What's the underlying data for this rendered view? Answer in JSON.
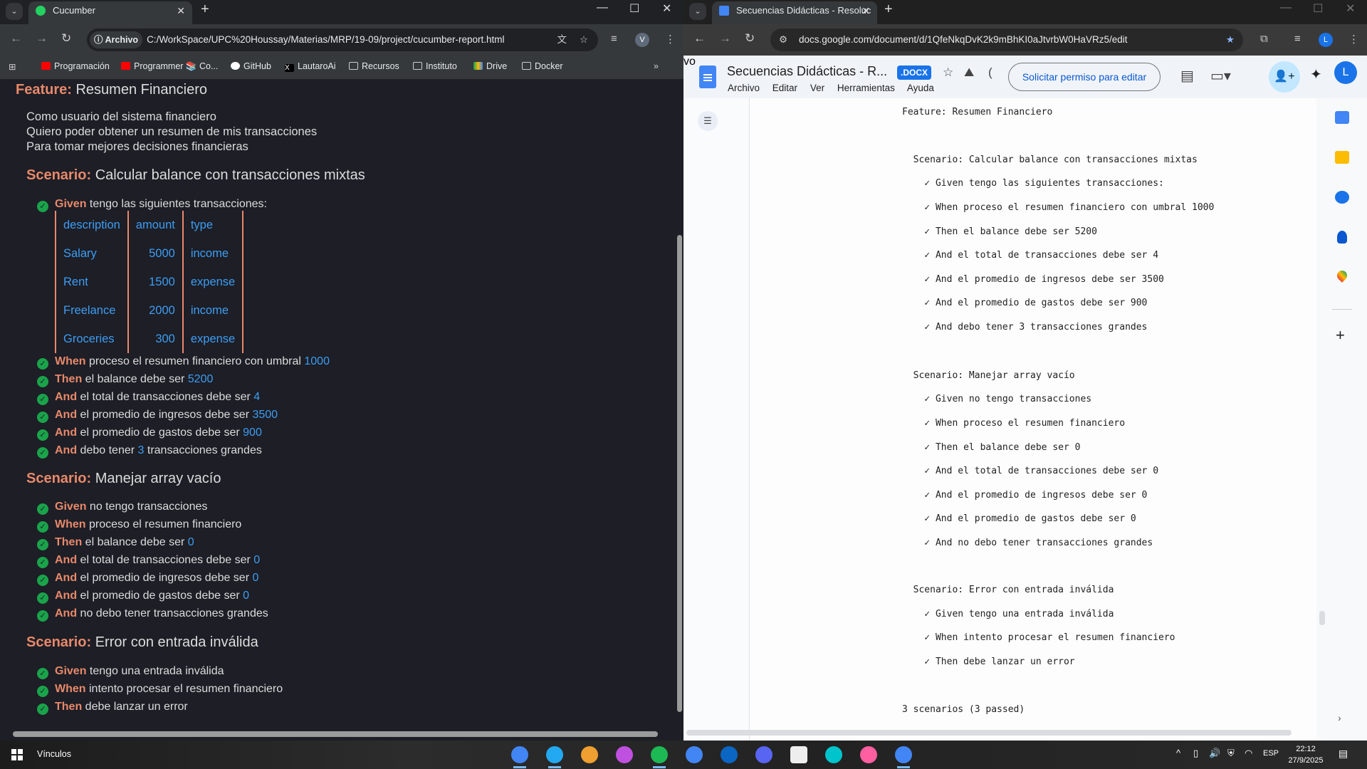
{
  "left_browser": {
    "tab_title": "Cucumber",
    "omnibox_chip": "Archivo",
    "url": "C:/WorkSpace/UPC%20Houssay/Materias/MRP/19-09/project/cucumber-report.html",
    "profile_initial": "V",
    "bookmarks": [
      "Programación",
      "Programmer 📚 Co...",
      "GitHub",
      "LautaroAi",
      "Recursos",
      "Instituto",
      "Drive",
      "Docker"
    ],
    "more_bookmarks": "»"
  },
  "report": {
    "feature_kw": "Feature:",
    "feature_name": "Resumen Financiero",
    "description": [
      "Como usuario del sistema financiero",
      "Quiero poder obtener un resumen de mis transacciones",
      "Para tomar mejores decisiones financieras"
    ],
    "scenarios": [
      {
        "kw": "Scenario:",
        "name": "Calcular balance con transacciones mixtas",
        "table": {
          "headers": [
            "description",
            "amount",
            "type"
          ],
          "rows": [
            [
              "Salary",
              "5000",
              "income"
            ],
            [
              "Rent",
              "1500",
              "expense"
            ],
            [
              "Freelance",
              "2000",
              "income"
            ],
            [
              "Groceries",
              "300",
              "expense"
            ]
          ]
        },
        "steps": [
          {
            "kw": "Given",
            "pre": "tengo las siguientes transacciones:"
          },
          {
            "kw": "When",
            "pre": "proceso el resumen financiero con umbral ",
            "param": "1000"
          },
          {
            "kw": "Then",
            "pre": "el balance debe ser ",
            "param": "5200"
          },
          {
            "kw": "And",
            "pre": "el total de transacciones debe ser ",
            "param": "4"
          },
          {
            "kw": "And",
            "pre": "el promedio de ingresos debe ser ",
            "param": "3500"
          },
          {
            "kw": "And",
            "pre": "el promedio de gastos debe ser ",
            "param": "900"
          },
          {
            "kw": "And",
            "pre": "debo tener ",
            "param": "3",
            "post": " transacciones grandes"
          }
        ]
      },
      {
        "kw": "Scenario:",
        "name": "Manejar array vacío",
        "steps": [
          {
            "kw": "Given",
            "pre": "no tengo transacciones"
          },
          {
            "kw": "When",
            "pre": "proceso el resumen financiero"
          },
          {
            "kw": "Then",
            "pre": "el balance debe ser ",
            "param": "0"
          },
          {
            "kw": "And",
            "pre": "el total de transacciones debe ser ",
            "param": "0"
          },
          {
            "kw": "And",
            "pre": "el promedio de ingresos debe ser ",
            "param": "0"
          },
          {
            "kw": "And",
            "pre": "el promedio de gastos debe ser ",
            "param": "0"
          },
          {
            "kw": "And",
            "pre": "no debo tener transacciones grandes"
          }
        ]
      },
      {
        "kw": "Scenario:",
        "name": "Error con entrada inválida",
        "steps": [
          {
            "kw": "Given",
            "pre": "tengo una entrada inválida"
          },
          {
            "kw": "When",
            "pre": "intento procesar el resumen financiero"
          },
          {
            "kw": "Then",
            "pre": "debe lanzar un error"
          }
        ]
      }
    ]
  },
  "right_browser": {
    "tab_title": "Secuencias Didácticas - Resoluc",
    "url": "docs.google.com/document/d/1QfeNkqDvK2k9mBhKI0aJtvrbW0HaVRz5/edit",
    "profile_initial": "L",
    "doc_title": "Secuencias Didácticas - R...",
    "doc_badge": ".DOCX",
    "menus": [
      "Archivo",
      "Editar",
      "Ver",
      "Herramientas",
      "Ayuda"
    ],
    "request_edit": "Solicitar permiso para editar",
    "avatar_initial": "L",
    "doc_lines": [
      "Feature: Resumen Financiero",
      "  Scenario: Calcular balance con transacciones mixtas",
      "    ✓ Given tengo las siguientes transacciones:",
      "    ✓ When proceso el resumen financiero con umbral 1000",
      "    ✓ Then el balance debe ser 5200",
      "    ✓ And el total de transacciones debe ser 4",
      "    ✓ And el promedio de ingresos debe ser 3500",
      "    ✓ And el promedio de gastos debe ser 900",
      "    ✓ And debo tener 3 transacciones grandes",
      "  Scenario: Manejar array vacío",
      "    ✓ Given no tengo transacciones",
      "    ✓ When proceso el resumen financiero",
      "    ✓ Then el balance debe ser 0",
      "    ✓ And el total de transacciones debe ser 0",
      "    ✓ And el promedio de ingresos debe ser 0",
      "    ✓ And el promedio de gastos debe ser 0",
      "    ✓ And no debo tener transacciones grandes",
      "  Scenario: Error con entrada inválida",
      "    ✓ Given tengo una entrada inválida",
      "    ✓ When intento procesar el resumen financiero",
      "    ✓ Then debe lanzar un error",
      "3 scenarios (3 passed)"
    ]
  },
  "taskbar": {
    "links_label": "Vínculos",
    "language": "ESP",
    "time": "22:12",
    "date": "27/9/2025",
    "apps": [
      "chrome-profile-v",
      "vscode",
      "git-kraken",
      "copilot",
      "spotify",
      "chrome",
      "linkedin",
      "discord",
      "notion",
      "canva",
      "arc",
      "chrome-profile-l"
    ]
  }
}
